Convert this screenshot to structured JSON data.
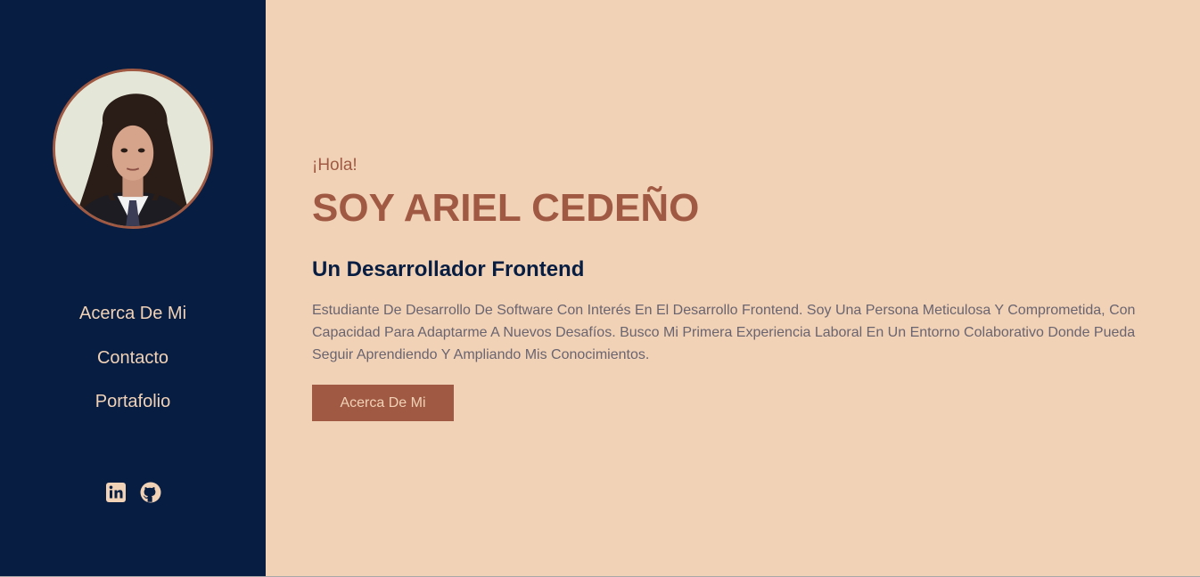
{
  "sidebar": {
    "avatar_alt": "Ariel Cedeño",
    "nav": [
      {
        "label": "Acerca De Mi"
      },
      {
        "label": "Contacto"
      },
      {
        "label": "Portafolio"
      }
    ],
    "socials": [
      {
        "icon": "linkedin-icon"
      },
      {
        "icon": "github-icon"
      }
    ]
  },
  "hero": {
    "greeting": "¡Hola!",
    "name": "SOY ARIEL CEDEÑO",
    "role": "Un Desarrollador Frontend",
    "bio": "Estudiante De Desarrollo De Software Con Interés En El Desarrollo Frontend. Soy Una Persona Meticulosa Y Comprometida, Con Capacidad Para Adaptarme A Nuevos Desafíos. Busco Mi Primera Experiencia Laboral En Un Entorno Colaborativo Donde Pueda Seguir Aprendiendo Y Ampliando Mis Conocimientos.",
    "cta_label": "Acerca De Mi"
  },
  "colors": {
    "sidebar_bg": "#071d42",
    "page_bg": "#f1d2b6",
    "accent": "#a05a43",
    "body_text": "#6a6470"
  }
}
